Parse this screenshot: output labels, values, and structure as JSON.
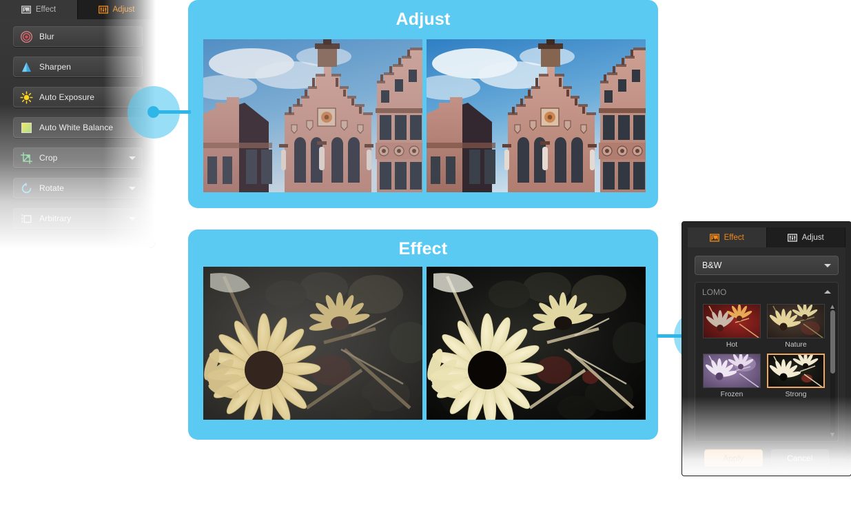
{
  "left_panel": {
    "tabs": [
      {
        "label": "Effect",
        "icon": "picture-icon",
        "active": false
      },
      {
        "label": "Adjust",
        "icon": "sliders-icon",
        "active": true
      }
    ],
    "items": [
      {
        "label": "Blur",
        "icon": "blur-target-icon",
        "has_chevron": false
      },
      {
        "label": "Sharpen",
        "icon": "triangle-icon",
        "has_chevron": false
      },
      {
        "label": "Auto Exposure",
        "icon": "sun-icon",
        "has_chevron": false
      },
      {
        "label": "Auto White Balance",
        "icon": "gradient-square-icon",
        "has_chevron": false
      },
      {
        "label": "Crop",
        "icon": "crop-icon",
        "has_chevron": true
      },
      {
        "label": "Rotate",
        "icon": "rotate-icon",
        "has_chevron": true
      },
      {
        "label": "Arbitrary",
        "icon": "arbitrary-icon",
        "has_chevron": true
      }
    ]
  },
  "cards": [
    {
      "title": "Adjust",
      "images": [
        {
          "name": "before-building-photo",
          "caption": ""
        },
        {
          "name": "after-building-photo",
          "caption": ""
        }
      ]
    },
    {
      "title": "Effect",
      "images": [
        {
          "name": "before-sunflower-photo",
          "caption": ""
        },
        {
          "name": "after-sunflower-photo",
          "caption": ""
        }
      ]
    }
  ],
  "right_panel": {
    "tabs": [
      {
        "label": "Effect",
        "icon": "picture-icon",
        "active": true
      },
      {
        "label": "Adjust",
        "icon": "sliders-icon",
        "active": false
      }
    ],
    "preset_select": {
      "value": "B&W"
    },
    "group": {
      "label": "LOMO",
      "expanded": true
    },
    "thumbnails": [
      {
        "label": "Hot",
        "selected": false
      },
      {
        "label": "Nature",
        "selected": false
      },
      {
        "label": "Frozen",
        "selected": false
      },
      {
        "label": "Strong",
        "selected": true
      }
    ],
    "actions": [
      {
        "label": "Apply",
        "kind": "primary"
      },
      {
        "label": "Cancel",
        "kind": "secondary"
      }
    ]
  },
  "colors": {
    "accent_blue": "#5bcaf2",
    "dot_blue": "#2fb6e8",
    "active_orange": "#f08a1a",
    "selected_border": "#f0a860",
    "panel_dark": "#2b2b2b"
  }
}
